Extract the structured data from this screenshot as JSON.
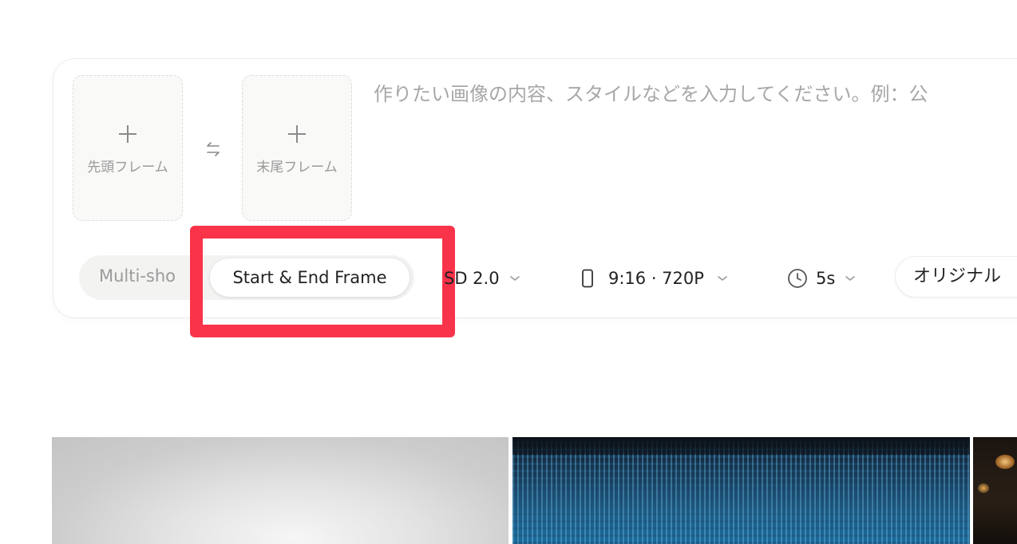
{
  "frames": {
    "start_label": "先頭フレーム",
    "end_label": "末尾フレーム"
  },
  "prompt": {
    "placeholder": "作りたい画像の内容、スタイルなどを入力してください。例：公"
  },
  "mode_toggle": {
    "options": [
      "Multi-shot",
      "Start & End Frame"
    ],
    "visible_partial_label": "Multi-sho",
    "active": "Start & End Frame"
  },
  "settings": {
    "model": "SD 2.0",
    "aspect_ratio": "9:16 · 720P",
    "duration": "5s",
    "style": "オリジナル"
  },
  "icons": {
    "add_frame": "plus-icon",
    "swap": "swap-arrows-icon",
    "portrait": "phone-portrait-icon",
    "clock": "clock-icon",
    "dropdown": "chevron-down-icon"
  },
  "colors": {
    "highlight": "#f9334a",
    "placeholder_text": "#a7a7a7",
    "toggle_bg": "#f3f3f2"
  }
}
